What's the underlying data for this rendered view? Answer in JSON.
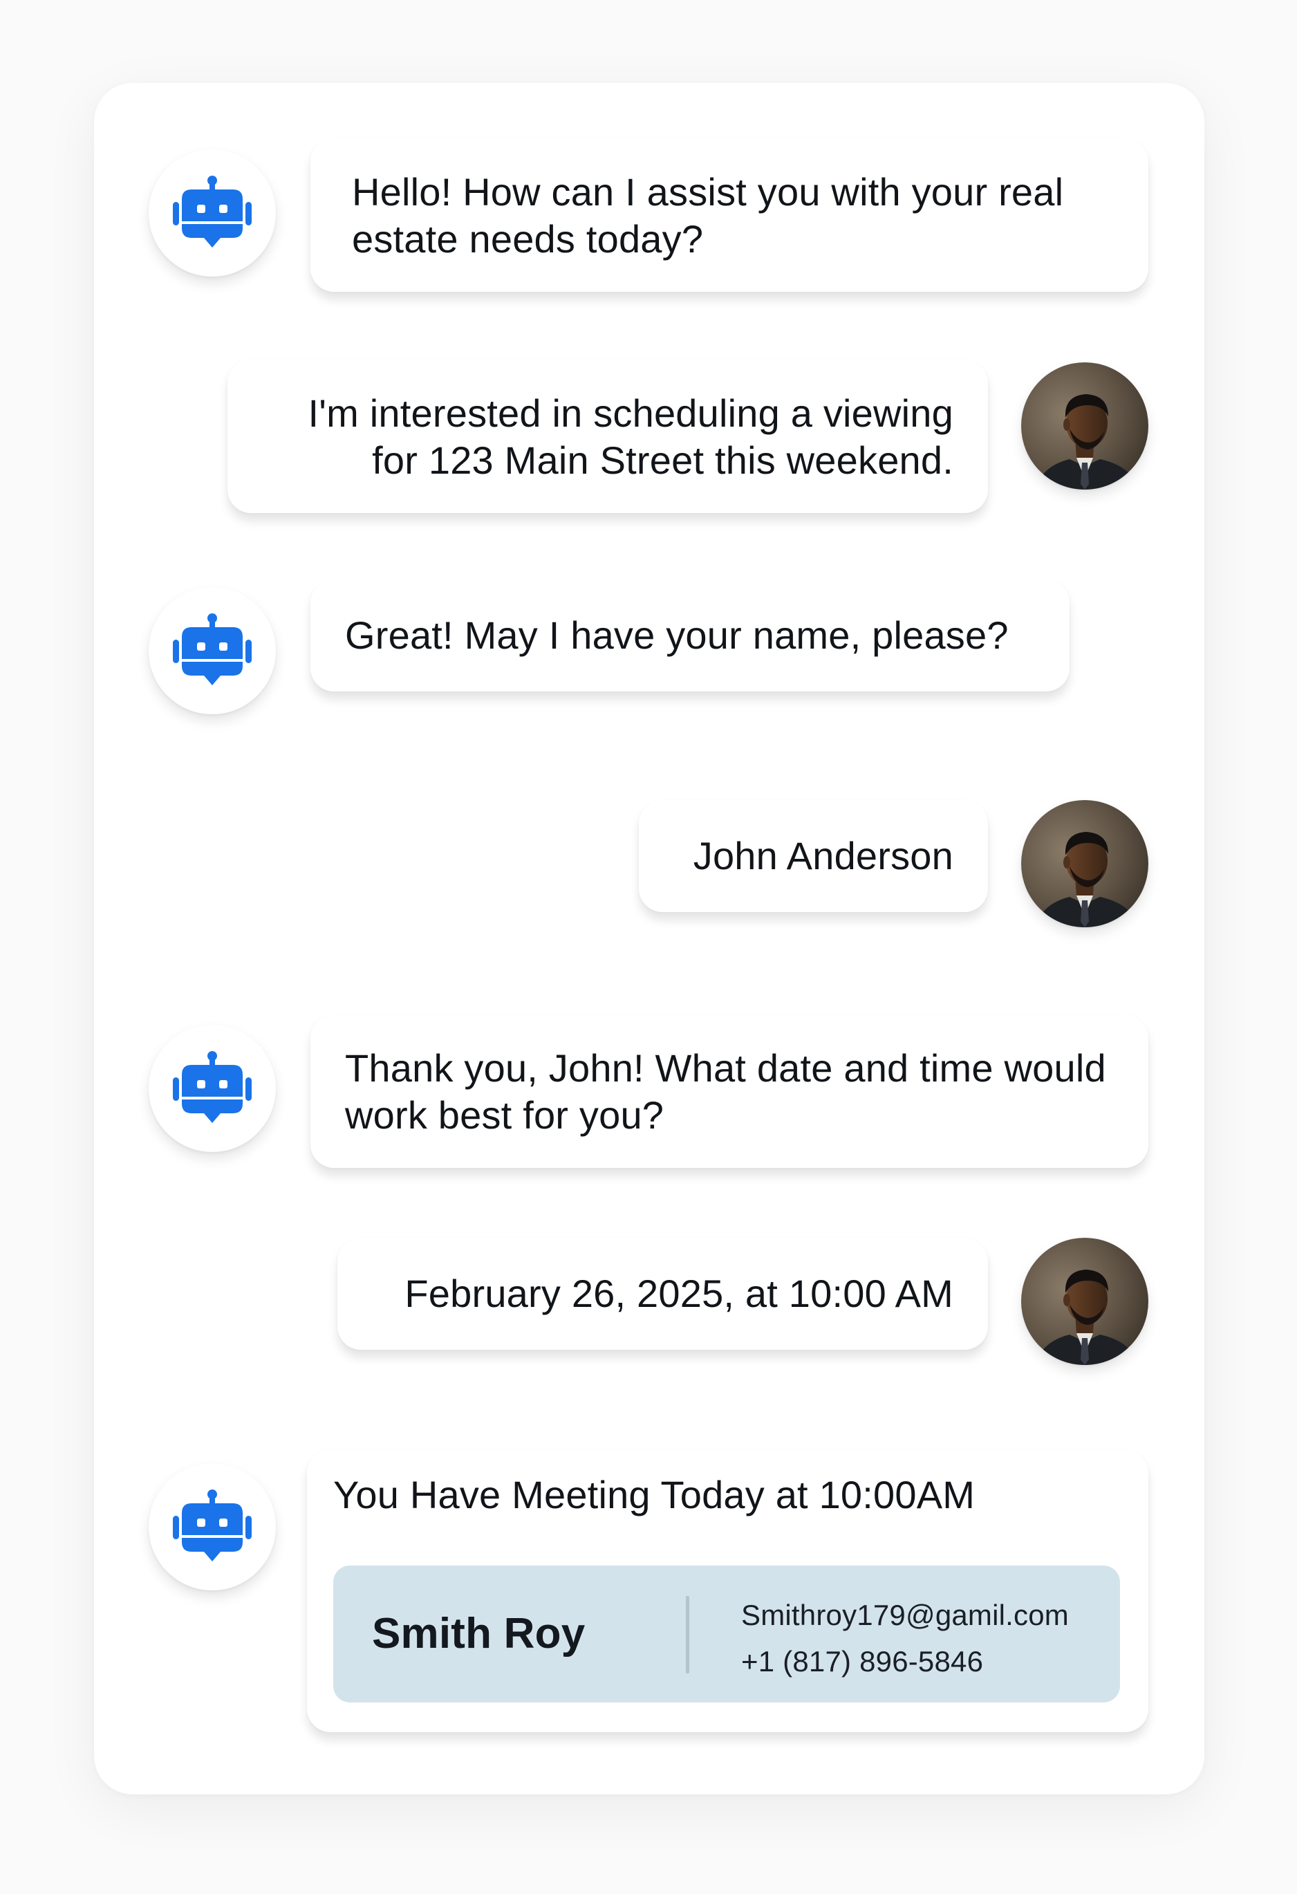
{
  "chat": {
    "messages": [
      {
        "sender": "bot",
        "text": "Hello! How can I assist you with your real estate needs today?"
      },
      {
        "sender": "user",
        "text": "I'm interested in scheduling a viewing for 123 Main Street this weekend."
      },
      {
        "sender": "bot",
        "text": "Great! May I have your name, please?"
      },
      {
        "sender": "user",
        "text": "John Anderson"
      },
      {
        "sender": "bot",
        "text": "Thank you, John! What date and time would work best for you?"
      },
      {
        "sender": "user",
        "text": "February 26, 2025, at 10:00 AM"
      }
    ],
    "meeting": {
      "title": "You Have Meeting Today at 10:00AM",
      "contact": {
        "name": "Smith Roy",
        "email": "Smithroy179@gamil.com",
        "phone": "+1 (817) 896-5846"
      }
    }
  },
  "icons": {
    "bot_avatar": "robot-icon",
    "user_avatar": "user-photo"
  },
  "colors": {
    "bot_icon": "#1a73e8",
    "contact_card_bg": "#d3e3ec",
    "card_bg": "#ffffff"
  }
}
